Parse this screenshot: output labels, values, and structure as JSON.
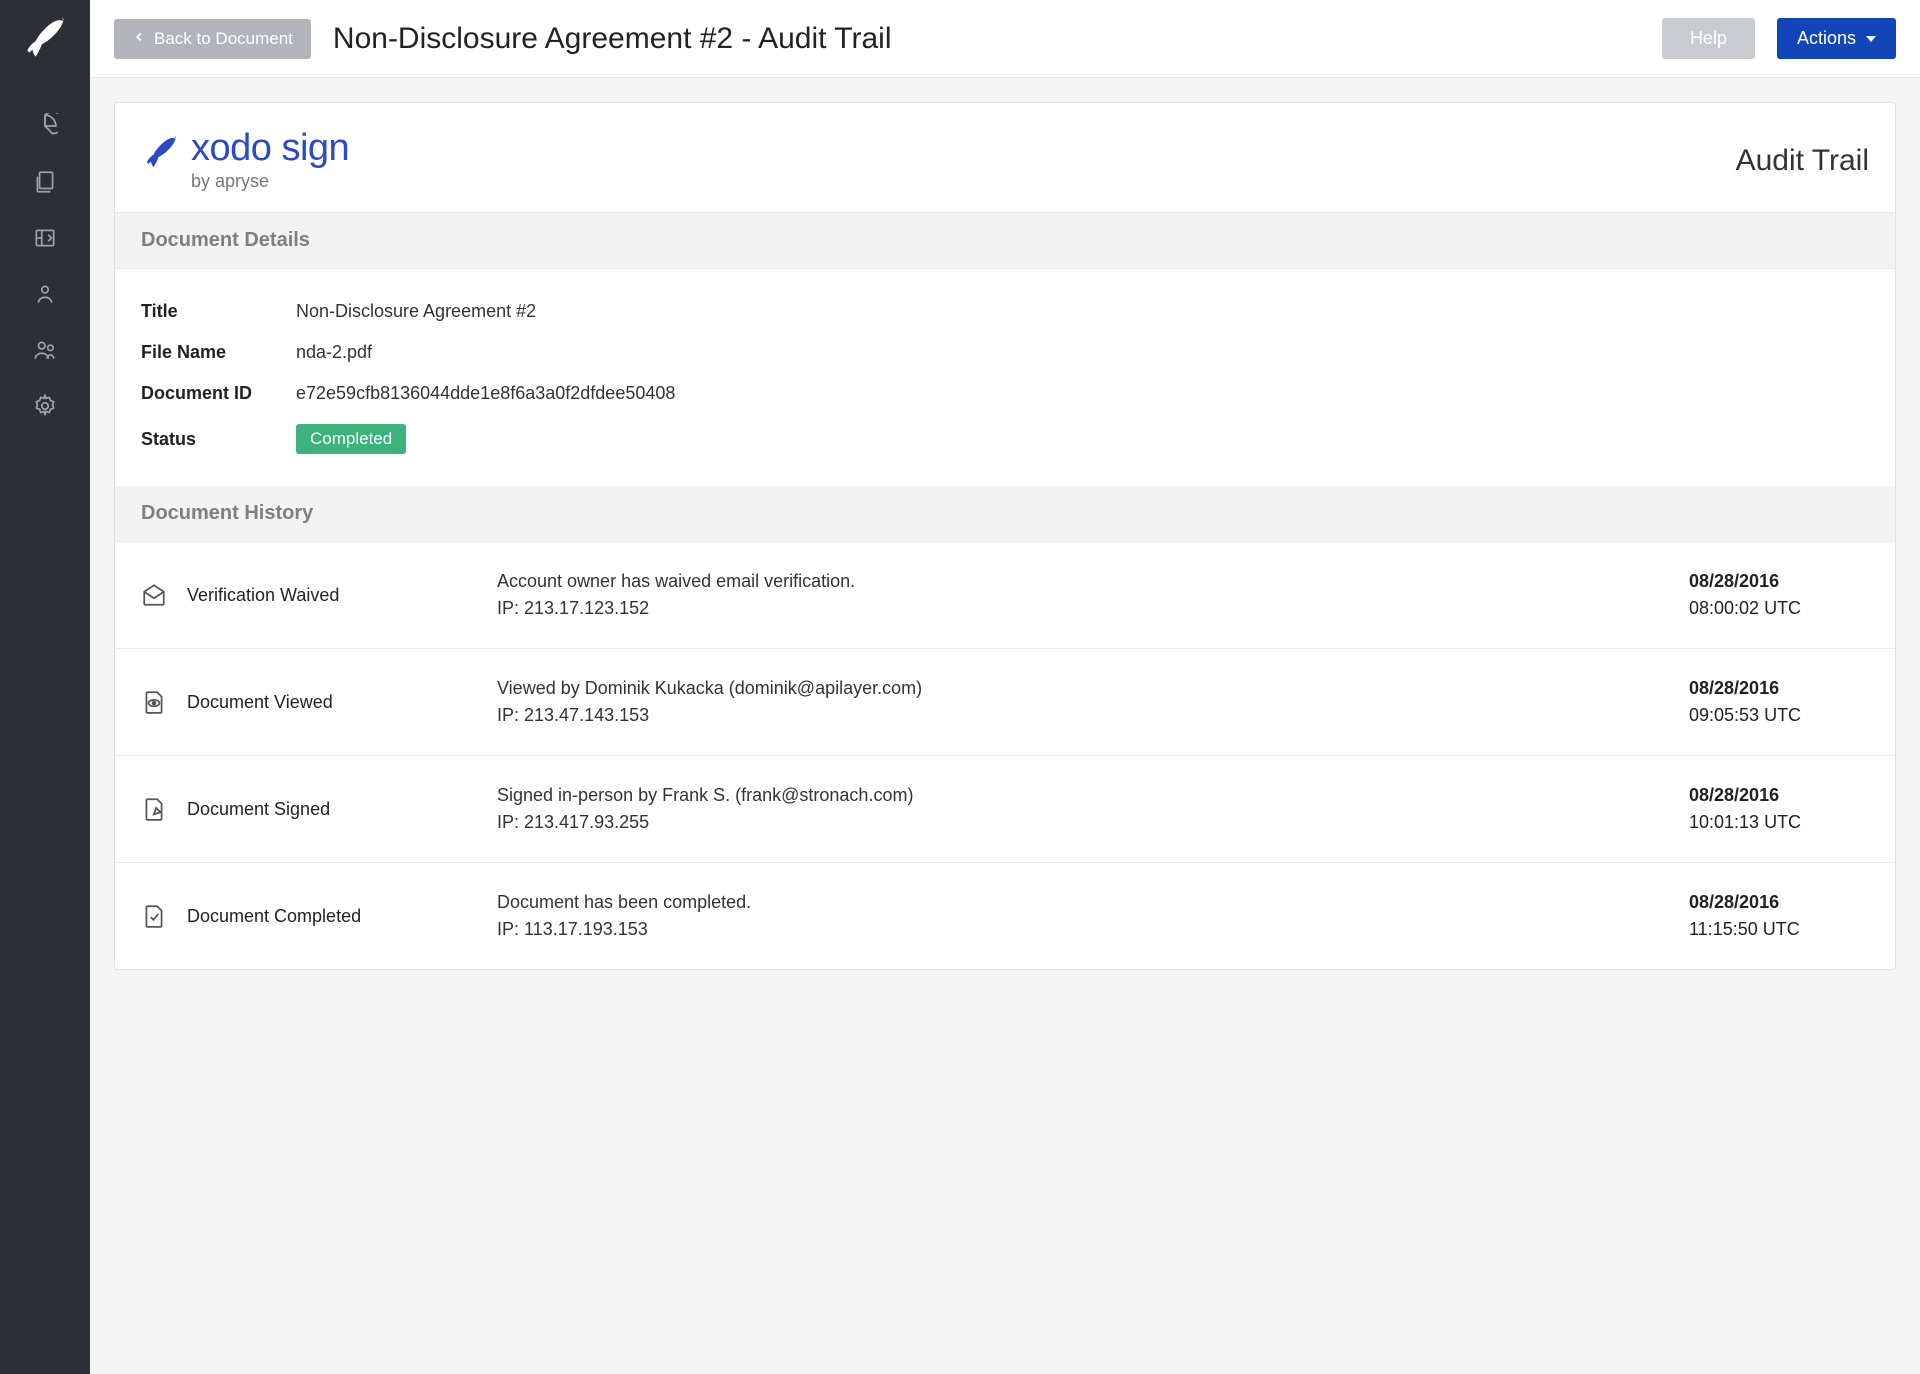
{
  "topbar": {
    "back_label": "Back to Document",
    "title": "Non-Disclosure Agreement #2 - Audit Trail",
    "help_label": "Help",
    "actions_label": "Actions"
  },
  "brand": {
    "name": "xodo sign",
    "sub": "by apryse"
  },
  "audit_title": "Audit Trail",
  "sections": {
    "details_header": "Document Details",
    "history_header": "Document History"
  },
  "details": {
    "title_label": "Title",
    "title_value": "Non-Disclosure Agreement #2",
    "filename_label": "File Name",
    "filename_value": "nda-2.pdf",
    "docid_label": "Document ID",
    "docid_value": "e72e59cfb8136044dde1e8f6a3a0f2dfdee50408",
    "status_label": "Status",
    "status_value": "Completed"
  },
  "history": [
    {
      "icon": "envelope-open-icon",
      "label": "Verification Waived",
      "desc": "Account owner has waived email verification.",
      "ip": "IP: 213.17.123.152",
      "date": "08/28/2016",
      "time": "08:00:02 UTC"
    },
    {
      "icon": "eye-document-icon",
      "label": "Document Viewed",
      "desc": "Viewed by Dominik Kukacka (dominik@apilayer.com)",
      "ip": "IP: 213.47.143.153",
      "date": "08/28/2016",
      "time": "09:05:53 UTC"
    },
    {
      "icon": "sign-document-icon",
      "label": "Document Signed",
      "desc": "Signed in-person by Frank S. (frank@stronach.com)",
      "ip": "IP: 213.417.93.255",
      "date": "08/28/2016",
      "time": "10:01:13 UTC"
    },
    {
      "icon": "check-document-icon",
      "label": "Document Completed",
      "desc": "Document has been completed.",
      "ip": "IP: 113.17.193.153",
      "date": "08/28/2016",
      "time": "11:15:50 UTC"
    }
  ]
}
